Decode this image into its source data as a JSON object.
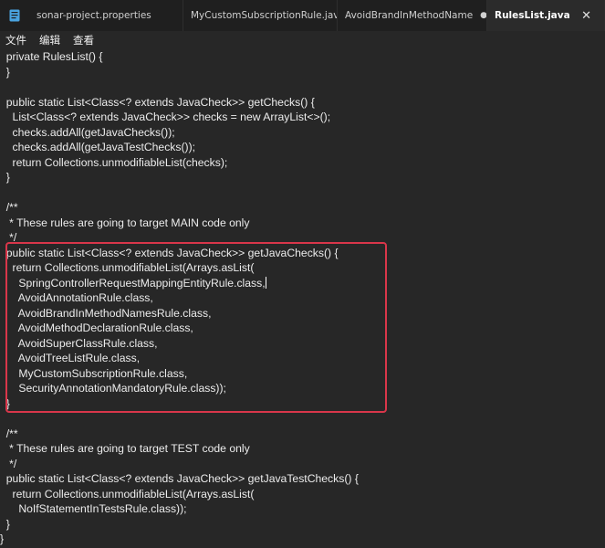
{
  "tabs": [
    {
      "label": "sonar-project.properties",
      "active": false
    },
    {
      "label": "MyCustomSubscriptionRule.java",
      "active": false
    },
    {
      "label": "AvoidBrandInMethodName",
      "active": false,
      "modified": true
    },
    {
      "label": "RulesList.java",
      "active": true
    }
  ],
  "icons": {
    "app": "document-icon",
    "close": "close-icon",
    "modified": "unsaved-dot-icon"
  },
  "close_glyph": "✕",
  "modified_glyph": "●",
  "menu": [
    "文件",
    "编辑",
    "查看"
  ],
  "code_lines": [
    "  private RulesList() {",
    "  }",
    "",
    "  public static List<Class<? extends JavaCheck>> getChecks() {",
    "    List<Class<? extends JavaCheck>> checks = new ArrayList<>();",
    "    checks.addAll(getJavaChecks());",
    "    checks.addAll(getJavaTestChecks());",
    "    return Collections.unmodifiableList(checks);",
    "  }",
    "",
    "  /**",
    "   * These rules are going to target MAIN code only",
    "   */",
    "  public static List<Class<? extends JavaCheck>> getJavaChecks() {",
    "    return Collections.unmodifiableList(Arrays.asList(",
    "      SpringControllerRequestMappingEntityRule.class,",
    "      AvoidAnnotationRule.class,",
    "      AvoidBrandInMethodNamesRule.class,",
    "      AvoidMethodDeclarationRule.class,",
    "      AvoidSuperClassRule.class,",
    "      AvoidTreeListRule.class,",
    "      MyCustomSubscriptionRule.class,",
    "      SecurityAnnotationMandatoryRule.class));",
    "  }",
    "",
    "  /**",
    "   * These rules are going to target TEST code only",
    "   */",
    "  public static List<Class<? extends JavaCheck>> getJavaTestChecks() {",
    "    return Collections.unmodifiableList(Arrays.asList(",
    "      NoIfStatementInTestsRule.class));",
    "  }",
    "}"
  ],
  "colors": {
    "highlight_border": "#d9364a",
    "background": "#272727",
    "tabbar": "#1f1f1f",
    "app_icon": "#4aa3e0"
  }
}
